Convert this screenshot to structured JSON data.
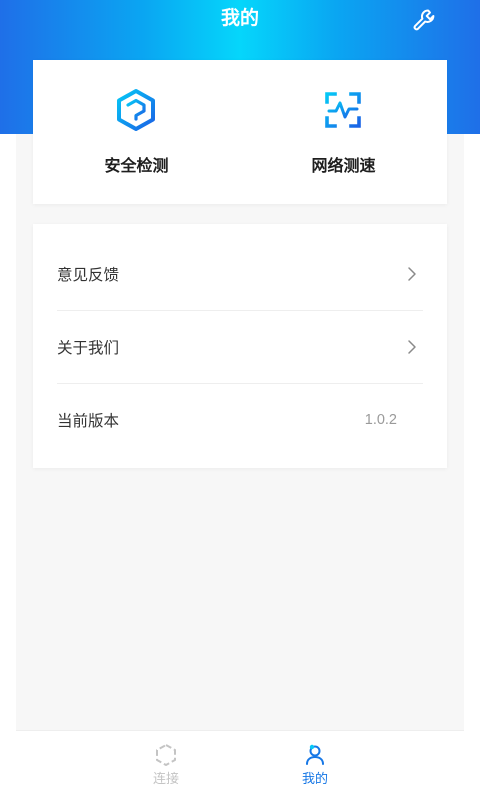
{
  "header": {
    "title": "我的",
    "settings_icon": "wrench-icon"
  },
  "tools": [
    {
      "label": "安全检测",
      "icon": "security-cube-icon"
    },
    {
      "label": "网络测速",
      "icon": "speed-scan-icon"
    }
  ],
  "menu": {
    "feedback": {
      "label": "意见反馈"
    },
    "about": {
      "label": "关于我们"
    },
    "version": {
      "label": "当前版本",
      "value": "1.0.2"
    }
  },
  "tabbar": {
    "connect": {
      "label": "连接",
      "icon": "hexagon-icon"
    },
    "mine": {
      "label": "我的",
      "icon": "user-icon"
    }
  },
  "colors": {
    "accent": "#1677e6",
    "header_gradient_mid": "#05d6fb",
    "header_gradient_edge": "#1f6fe8",
    "inactive_tab": "#c4c4c4",
    "text": "#333333",
    "secondary_text": "#9a9a9a"
  }
}
